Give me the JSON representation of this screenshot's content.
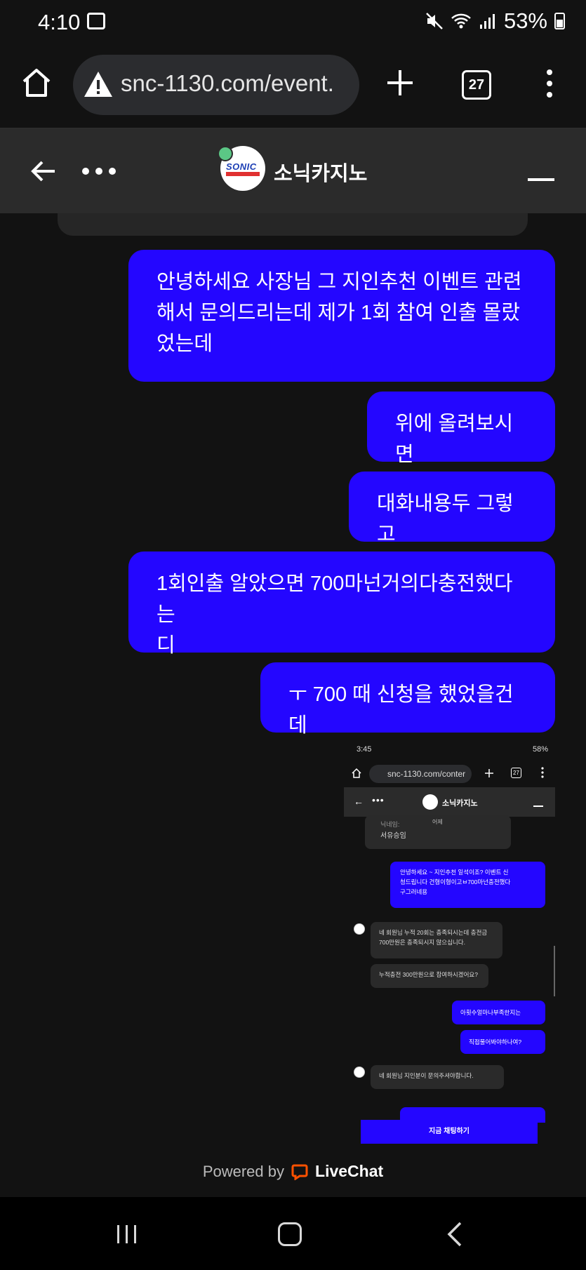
{
  "status_bar": {
    "time": "4:10",
    "battery": "53%",
    "icons": [
      "gallery-icon",
      "mute-icon",
      "wifi-icon",
      "signal-icon",
      "battery-icon"
    ]
  },
  "browser": {
    "url": "snc-1130.com/event.",
    "tab_count": "27",
    "icons": [
      "home-icon",
      "warning-icon",
      "plus-icon",
      "tabs-icon",
      "menu-icon"
    ]
  },
  "chat_header": {
    "title": "소닉카지노",
    "logo_text": "SONIC",
    "online_color": "#5bc785"
  },
  "messages": [
    {
      "text": "안녕하세요 사장님 그 지인추천 이벤트 관련\n해서 문의드리는데 제가 1회 참여 인출 몰랐\n었는데"
    },
    {
      "text": "위에 올려보시면"
    },
    {
      "text": "대화내용두 그렇고"
    },
    {
      "text": "1회인출 알았으면 700마넌거의다충전했다는\n디"
    },
    {
      "text": "ㅜ 700 때 신청을 했었을건데"
    }
  ],
  "attached_screenshot": {
    "time": "3:45",
    "battery": "58%",
    "url": "snc-1130.com/conter",
    "tab_count": "27",
    "title": "소닉카지노",
    "prev_label": "닉네임:",
    "prev_value": "서유승임",
    "day_label": "어제",
    "user_msg_1": "안녕하세요 ~ 지인추천 일석이조? 이벤트 신\n청드립니다 건형이형이고ㅂ700마넌충전했다\n구그러네용",
    "agent_msg_1": "네 회원님 누적 20회는 충족되시는데 충전금\n700만원은 충족되시지 않으십니다.",
    "agent_msg_2": "누적충전 300만원으로 참여하시겠어요?",
    "user_msg_2": "아횟수얼마나부족한지는",
    "user_msg_3": "직접물어봐야하나여?",
    "agent_msg_3": "네 회원님 지인분이 문의주셔야합니다.",
    "button": "지금 채팅하기"
  },
  "footer": {
    "powered_by": "Powered by",
    "brand": "LiveChat",
    "brand_color": "#ff5100"
  },
  "accent_color": "#2406ff"
}
